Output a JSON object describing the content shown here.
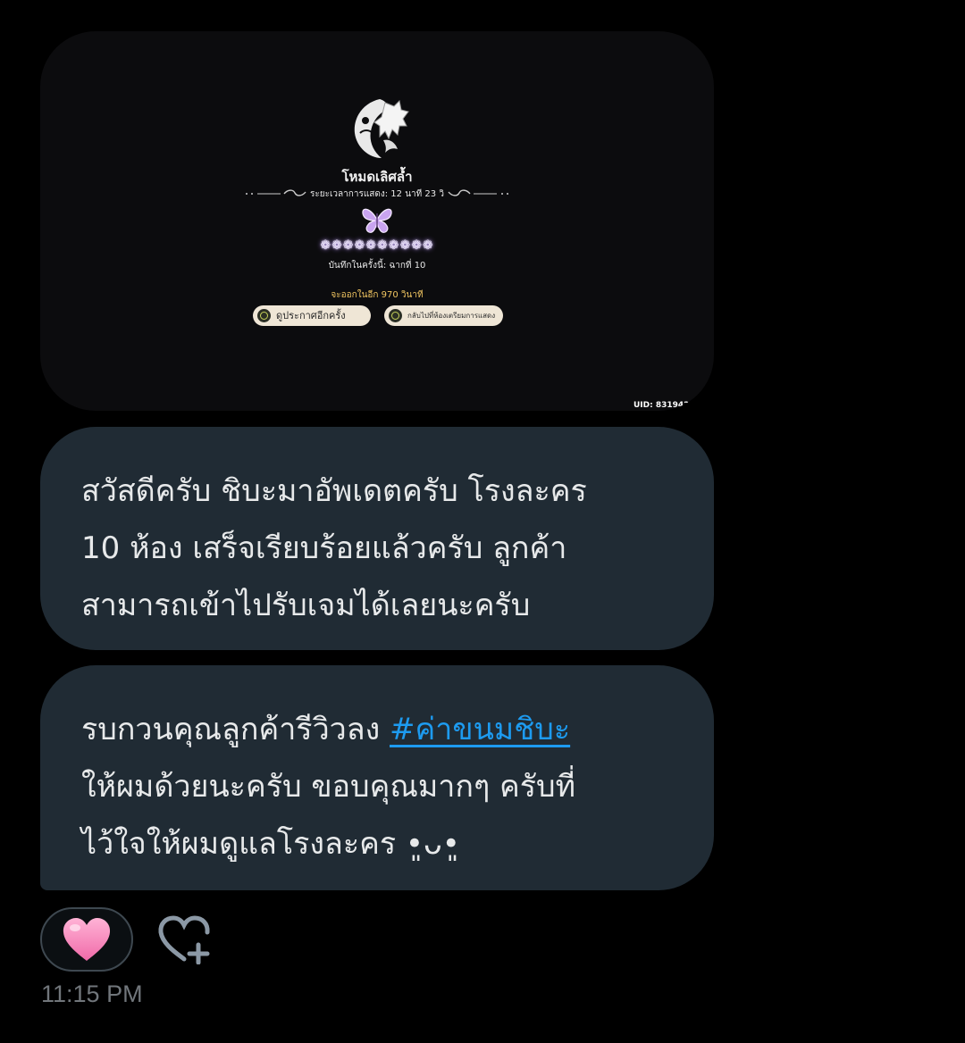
{
  "attachment": {
    "mode_title": "โหมดเลิศล้ำ",
    "duration_label": "ระยะเวลาการแสดง: 12 นาที 23 วิ",
    "stars": "❁❁❁❁❁❁❁❁❁❁",
    "record_label": "บันทึกในครั้งนี้: ฉากที่ 10",
    "leave_timer": "จะออกในอีก 970 วินาที",
    "replay_button": "ดูประกาศอีกครั้ง",
    "back_button": "กลับไปที่ห้องเตรียมการแสดง",
    "uid": "UID: 8319420"
  },
  "messages": [
    {
      "lines": [
        "สวัสดีครับ ชิบะมาอัพเดตครับ โรงละคร",
        "10 ห้อง เสร็จเรียบร้อยแล้วครับ ลูกค้า",
        "สามารถเข้าไปรับเจมได้เลยนะครับ"
      ]
    },
    {
      "line1_prefix": "รบกวนคุณลูกค้ารีวิวลง ",
      "hashtag": "#ค่าขนมชิบะ",
      "line2": "ให้ผมด้วยนะครับ  ขอบคุณมากๆ ครับที่",
      "line3": "ไว้ใจให้ผมดูแลโรงละคร •͈ᴗ•͈"
    }
  ],
  "reaction": {
    "emoji": "pink-heart",
    "count": ""
  },
  "add_reaction_icon": "heart-plus-icon",
  "timestamp": "11:15 PM",
  "colors": {
    "background": "#000000",
    "bubble": "#202b34",
    "text": "#e7e9ea",
    "link": "#1d9bf0",
    "muted": "#71767b",
    "heart": "#f472b6"
  }
}
